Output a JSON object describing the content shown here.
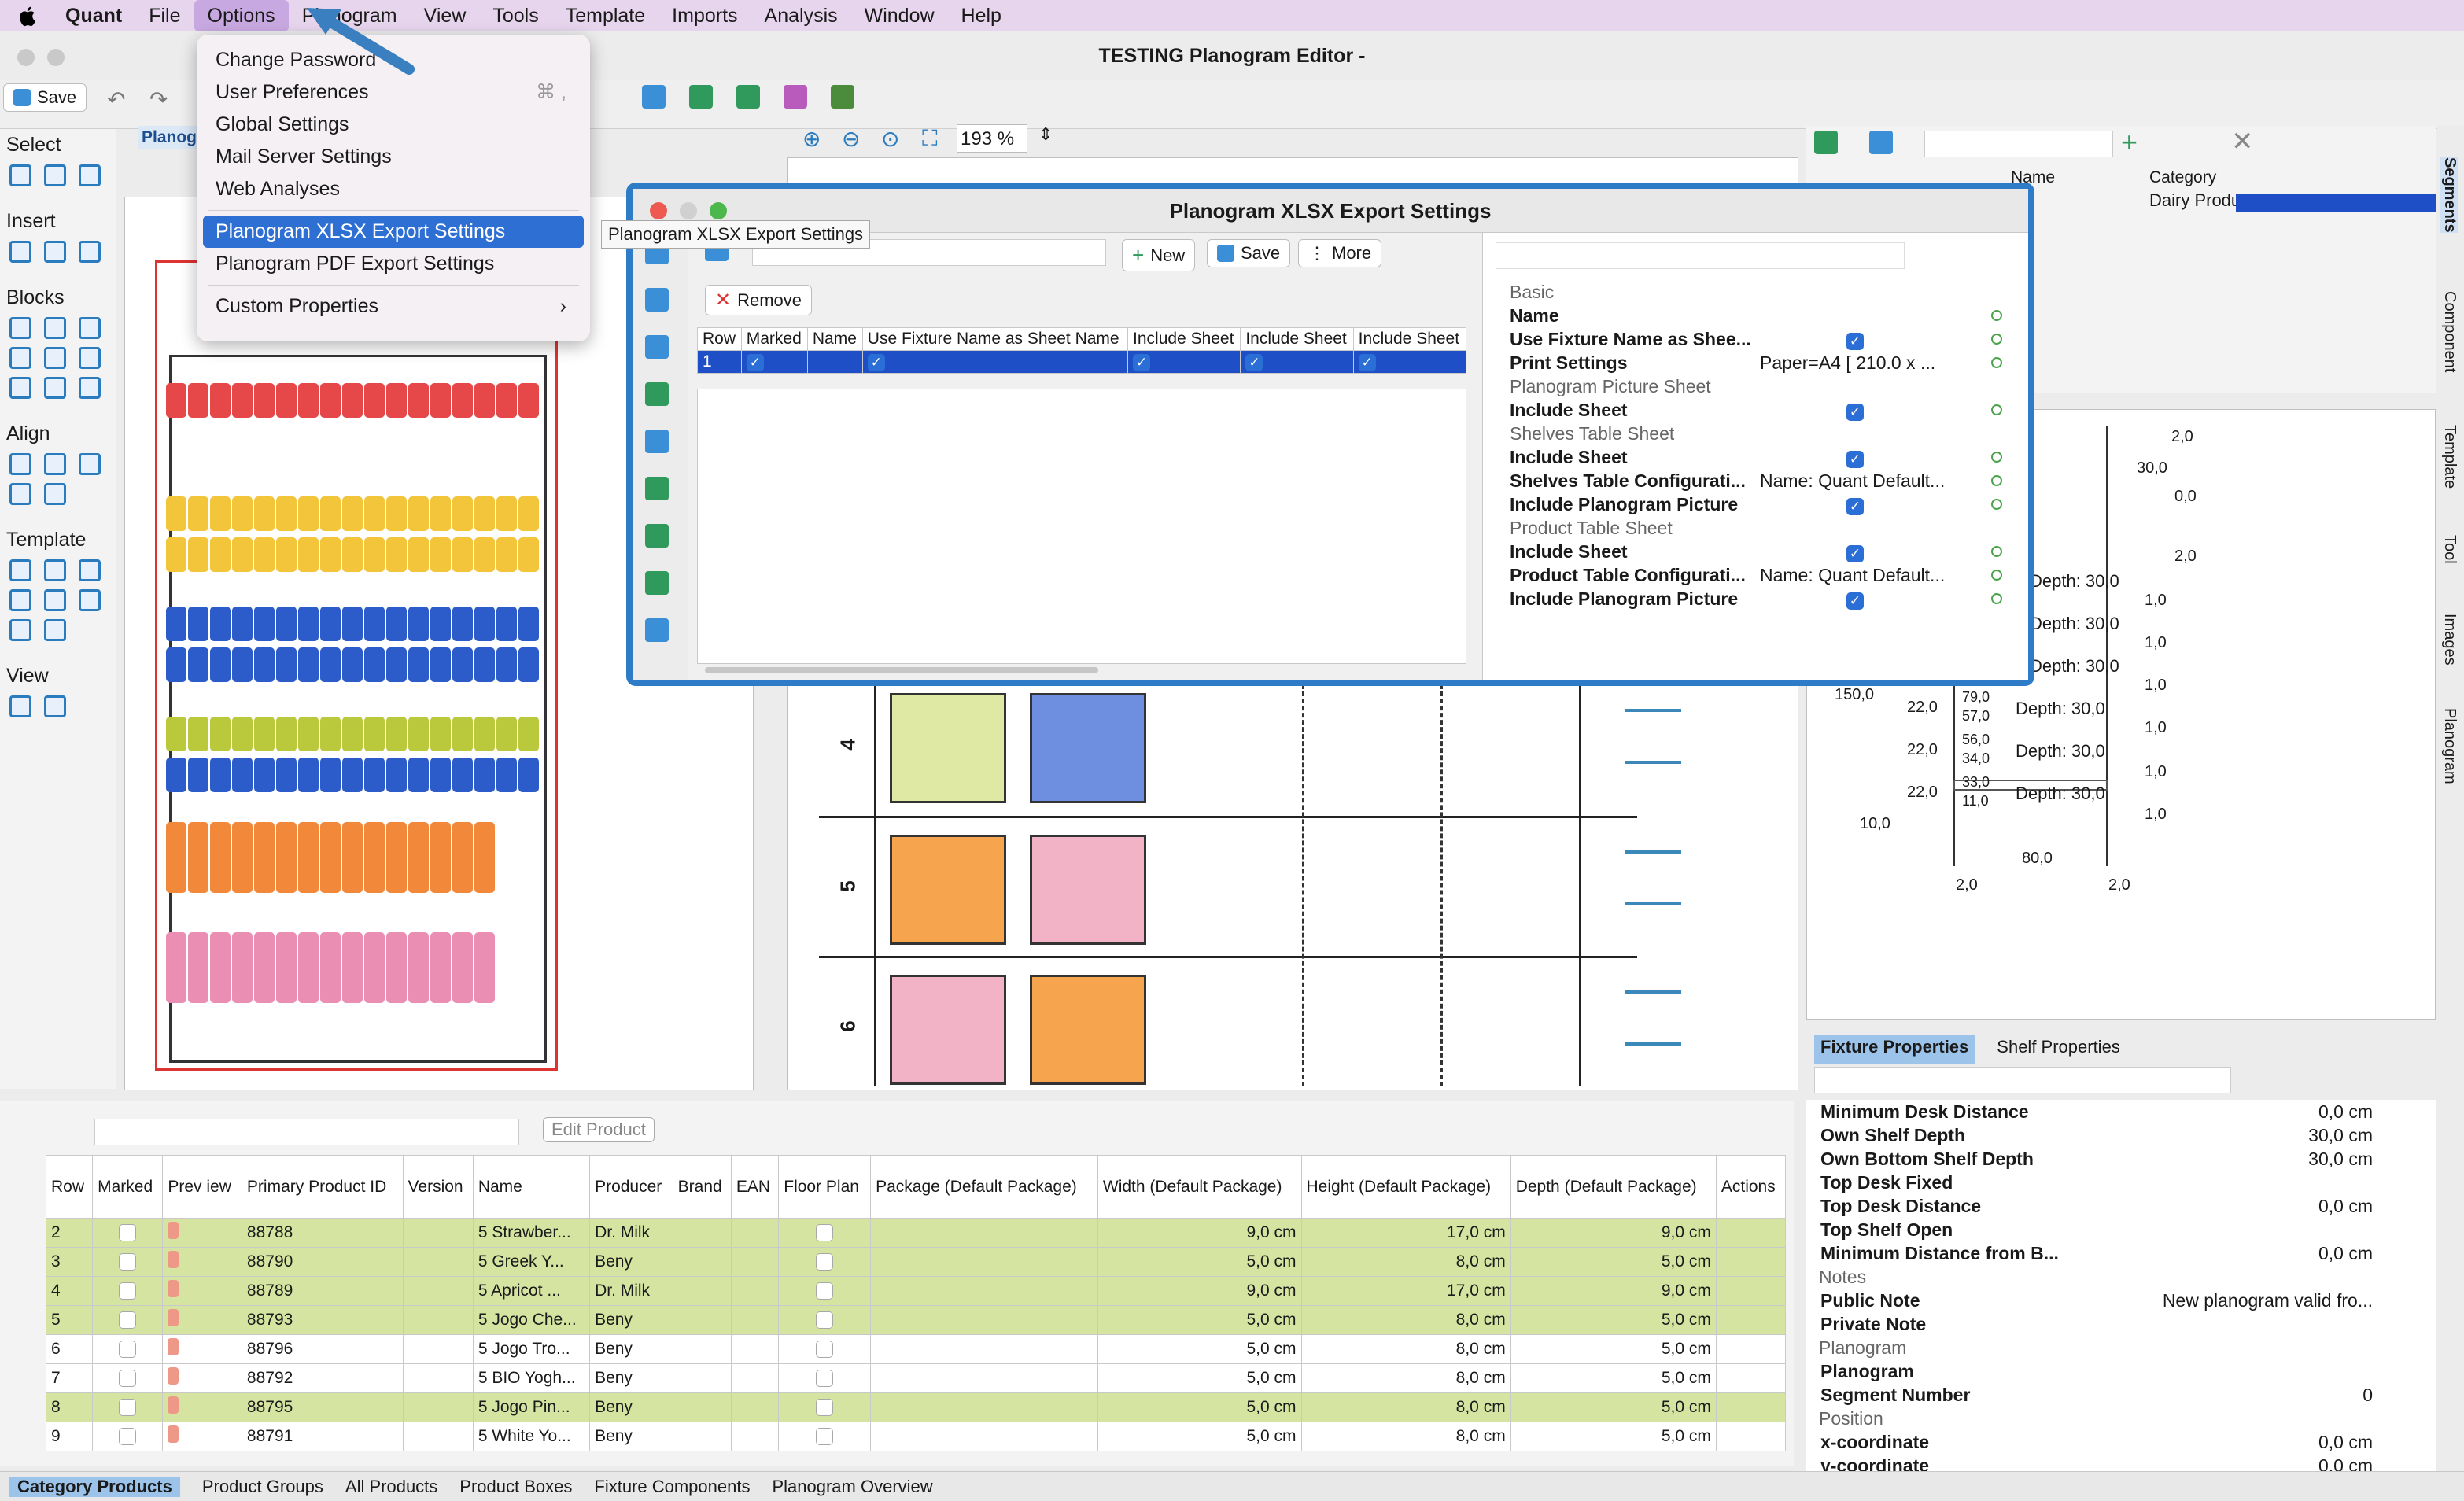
{
  "menubar": {
    "app": "Quant",
    "items": [
      "File",
      "Options",
      "Planogram",
      "View",
      "Tools",
      "Template",
      "Imports",
      "Analysis",
      "Window",
      "Help"
    ],
    "active": "Options"
  },
  "window": {
    "title": "TESTING Planogram Editor -"
  },
  "toolbar": {
    "save_label": "Save",
    "zoom": "193 %"
  },
  "left_panel": {
    "groups": [
      "Select",
      "Insert",
      "Blocks",
      "Align",
      "Template",
      "View"
    ],
    "tab_label": "Planog"
  },
  "options_menu": {
    "items": [
      "Change Password",
      "User Preferences",
      "Global Settings",
      "Mail Server Settings",
      "Web Analyses",
      "Planogram XLSX Export Settings",
      "Planogram PDF Export Settings",
      "Custom Properties"
    ],
    "shortcut": "⌘ ,",
    "selected": "Planogram XLSX Export Settings"
  },
  "tooltip": "Planogram XLSX Export Settings",
  "dialog": {
    "title": "Planogram XLSX Export Settings",
    "buttons": {
      "new": "New",
      "save": "Save",
      "more": "More",
      "remove": "Remove"
    },
    "columns": [
      "Row",
      "Marked",
      "Name",
      "Use Fixture Name as Sheet Name",
      "Include Sheet",
      "Include Sheet",
      "Include Sheet"
    ],
    "rows": [
      {
        "row": "1",
        "marked": true,
        "name": "",
        "use_fixture": true,
        "s1": true,
        "s2": true,
        "s3": true
      }
    ],
    "properties": [
      {
        "type": "header",
        "label": "Basic"
      },
      {
        "label": "Name",
        "value": ""
      },
      {
        "label": "Use Fixture Name as Shee...",
        "value": "check"
      },
      {
        "label": "Print Settings",
        "value": "Paper=A4 [ 210.0 x ..."
      },
      {
        "type": "header",
        "label": "Planogram Picture Sheet"
      },
      {
        "label": "Include Sheet",
        "value": "check"
      },
      {
        "type": "header",
        "label": "Shelves Table Sheet"
      },
      {
        "label": "Include Sheet",
        "value": "check"
      },
      {
        "label": "Shelves Table Configurati...",
        "value": "Name: Quant Default..."
      },
      {
        "label": "Include Planogram Picture",
        "value": "check"
      },
      {
        "type": "header",
        "label": "Product Table Sheet"
      },
      {
        "label": "Include Sheet",
        "value": "check"
      },
      {
        "label": "Product Table Configurati...",
        "value": "Name: Quant Default..."
      },
      {
        "label": "Include Planogram Picture",
        "value": "check"
      }
    ]
  },
  "center": {
    "shelf_labels": [
      "4",
      "5",
      "6"
    ]
  },
  "right_top": {
    "columns": [
      "Name",
      "Category"
    ],
    "category_value": "Dairy Produ..."
  },
  "diagram_labels": [
    "2,0",
    "30,0",
    "0,0",
    "2,0",
    "Depth: 30,0",
    "Depth: 30,0",
    "Depth: 30,0",
    "Depth: 30,0",
    "Depth: 30,0",
    "Depth: 30,0",
    "1,0",
    "1,0",
    "1,0",
    "1,0",
    "1,0",
    "1,0",
    "150,0",
    "22,0",
    "22,0",
    "22,0",
    "79,0",
    "57,0",
    "56,0",
    "34,0",
    "33,0",
    "11,0",
    "10,0",
    "80,0",
    "2,0",
    "2,0"
  ],
  "right_tabs": [
    "Segments",
    "Component",
    "Template",
    "Tool",
    "Images",
    "Planogram"
  ],
  "fixture_props": {
    "tabs": [
      "Fixture Properties",
      "Shelf Properties"
    ],
    "rows": [
      {
        "label": "Minimum Desk Distance",
        "value": "0,0 cm"
      },
      {
        "label": "Own Shelf Depth",
        "value": "30,0 cm"
      },
      {
        "label": "Own Bottom Shelf Depth",
        "value": "30,0 cm"
      },
      {
        "label": "Top Desk Fixed",
        "value": ""
      },
      {
        "label": "Top Desk Distance",
        "value": "0,0 cm"
      },
      {
        "label": "Top Shelf Open",
        "value": ""
      },
      {
        "label": "Minimum Distance from B...",
        "value": "0,0 cm"
      },
      {
        "type": "header",
        "label": "Notes"
      },
      {
        "label": "Public Note",
        "value": "New planogram valid fro..."
      },
      {
        "label": "Private Note",
        "value": ""
      },
      {
        "type": "header",
        "label": "Planogram"
      },
      {
        "label": "Planogram",
        "value": ""
      },
      {
        "label": "Segment Number",
        "value": "0"
      },
      {
        "type": "header",
        "label": "Position"
      },
      {
        "label": "x-coordinate",
        "value": "0,0 cm"
      },
      {
        "label": "y-coordinate",
        "value": "0,0 cm"
      }
    ]
  },
  "products": {
    "edit_label": "Edit Product",
    "columns": [
      "Row",
      "Marked",
      "Prev iew",
      "Primary Product ID",
      "Version",
      "Name",
      "Producer",
      "Brand",
      "EAN",
      "Floor Plan",
      "Package (Default Package)",
      "Width (Default Package)",
      "Height (Default Package)",
      "Depth (Default Package)",
      "Actions"
    ],
    "rows": [
      {
        "row": "2",
        "id": "88788",
        "name": "5 Strawber...",
        "producer": "Dr. Milk",
        "width": "9,0 cm",
        "height": "17,0 cm",
        "depth": "9,0 cm",
        "hl": true
      },
      {
        "row": "3",
        "id": "88790",
        "name": "5 Greek Y...",
        "producer": "Beny",
        "width": "5,0 cm",
        "height": "8,0 cm",
        "depth": "5,0 cm",
        "hl": true
      },
      {
        "row": "4",
        "id": "88789",
        "name": "5 Apricot ...",
        "producer": "Dr. Milk",
        "width": "9,0 cm",
        "height": "17,0 cm",
        "depth": "9,0 cm",
        "hl": true
      },
      {
        "row": "5",
        "id": "88793",
        "name": "5 Jogo Che...",
        "producer": "Beny",
        "width": "5,0 cm",
        "height": "8,0 cm",
        "depth": "5,0 cm",
        "hl": true
      },
      {
        "row": "6",
        "id": "88796",
        "name": "5 Jogo Tro...",
        "producer": "Beny",
        "width": "5,0 cm",
        "height": "8,0 cm",
        "depth": "5,0 cm",
        "hl": false
      },
      {
        "row": "7",
        "id": "88792",
        "name": "5 BIO Yogh...",
        "producer": "Beny",
        "width": "5,0 cm",
        "height": "8,0 cm",
        "depth": "5,0 cm",
        "hl": false
      },
      {
        "row": "8",
        "id": "88795",
        "name": "5 Jogo Pin...",
        "producer": "Beny",
        "width": "5,0 cm",
        "height": "8,0 cm",
        "depth": "5,0 cm",
        "hl": true
      },
      {
        "row": "9",
        "id": "88791",
        "name": "5 White Yo...",
        "producer": "Beny",
        "width": "5,0 cm",
        "height": "8,0 cm",
        "depth": "5,0 cm",
        "hl": false
      }
    ]
  },
  "bottom_tabs": [
    "Category Products",
    "Product Groups",
    "All Products",
    "Product Boxes",
    "Fixture Components",
    "Planogram Overview"
  ],
  "colors": {
    "accent": "#2e7bc8",
    "selection": "#1e4fc7",
    "highlight_row": "#d6e4a1",
    "menubar": "#e6d5ec"
  }
}
